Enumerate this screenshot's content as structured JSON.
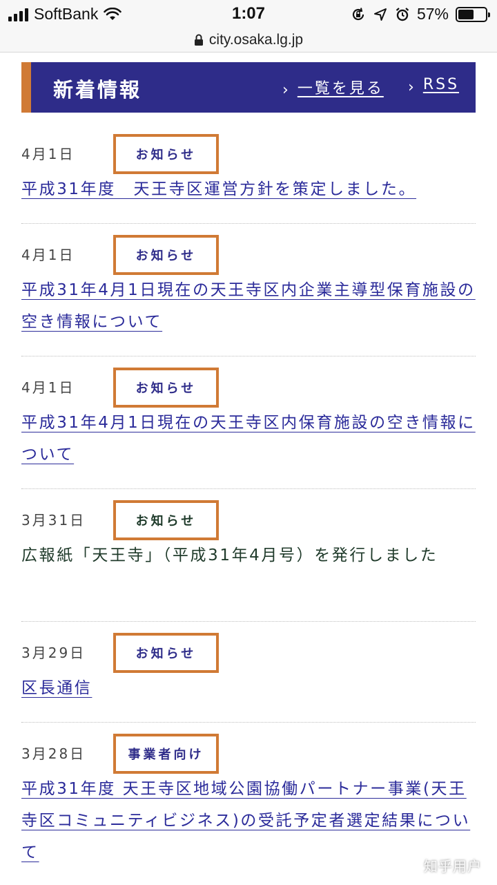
{
  "status_bar": {
    "carrier": "SoftBank",
    "time": "1:07",
    "battery": "57%",
    "battery_level": 0.57
  },
  "url_bar": {
    "url": "city.osaka.lg.jp"
  },
  "header": {
    "title": "新着情報",
    "list_link": "一覧を見る",
    "rss_link": "RSS"
  },
  "colors": {
    "header_bg": "#2e2c89",
    "accent_orange": "#d07a35",
    "link_blue": "#2b2b9a"
  },
  "news": [
    {
      "date": "4月1日",
      "badge": "お知らせ",
      "text": "平成31年度　天王寺区運営方針を策定しました。",
      "is_link": true
    },
    {
      "date": "4月1日",
      "badge": "お知らせ",
      "text": "平成31年4月1日現在の天王寺区内企業主導型保育施設の空き情報について",
      "is_link": true
    },
    {
      "date": "4月1日",
      "badge": "お知らせ",
      "text": "平成31年4月1日現在の天王寺区内保育施設の空き情報について",
      "is_link": true
    },
    {
      "date": "3月31日",
      "badge": "お知らせ",
      "text": "広報紙「天王寺」（平成31年4月号）を発行しました",
      "is_link": false
    },
    {
      "date": "3月29日",
      "badge": "お知らせ",
      "text": "区長通信",
      "is_link": true
    },
    {
      "date": "3月28日",
      "badge": "事業者向け",
      "text": "平成31年度 天王寺区地域公園協働パートナー事業(天王寺区コミュニティビジネス)の受託予定者選定結果について",
      "is_link": true
    }
  ],
  "watermark": "知乎用户"
}
